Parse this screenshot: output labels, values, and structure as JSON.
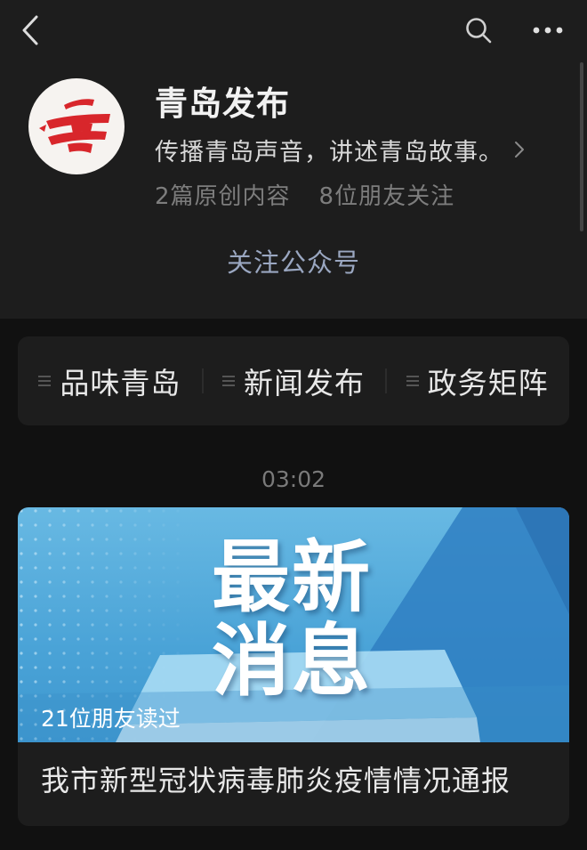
{
  "topbar": {
    "back_icon": "back-arrow-icon",
    "search_icon": "search-icon",
    "more_icon": "more-dots-icon"
  },
  "account": {
    "name": "青岛发布",
    "description": "传播青岛声音，讲述青岛故事。",
    "original_count": "2篇原创内容",
    "friends_following": "8位朋友关注",
    "follow_label": "关注公众号"
  },
  "menu": {
    "items": [
      {
        "label": "品味青岛",
        "icon": "menu-lines-icon"
      },
      {
        "label": "新闻发布",
        "icon": "menu-lines-icon"
      },
      {
        "label": "政务矩阵",
        "icon": "menu-lines-icon"
      }
    ]
  },
  "feed": {
    "timestamp": "03:02",
    "article": {
      "cover_line1": "最新",
      "cover_line2": "消息",
      "read_count": "21位朋友读过",
      "title": "我市新型冠状病毒肺炎疫情情况通报"
    }
  },
  "colors": {
    "background": "#111111",
    "header_bg": "#1d1d1d",
    "follow_text": "#9aa7c1",
    "logo_red": "#d8262b",
    "cover_blue": "#4aa3d7"
  }
}
